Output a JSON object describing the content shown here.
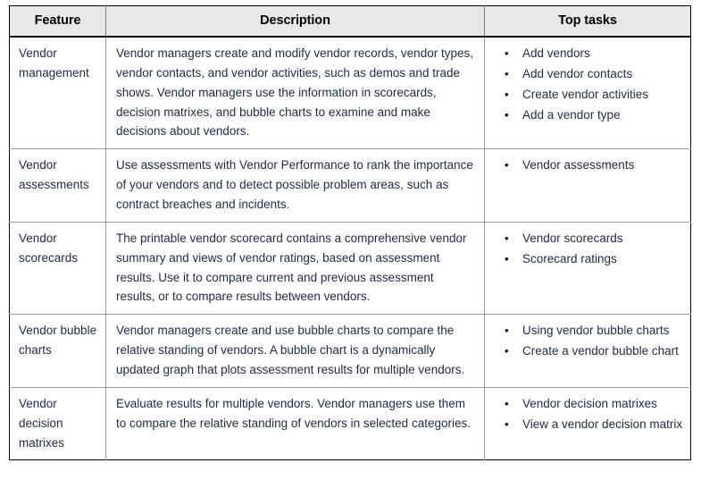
{
  "table": {
    "columns": [
      {
        "label": "Feature"
      },
      {
        "label": "Description"
      },
      {
        "label": "Top tasks"
      }
    ],
    "rows": [
      {
        "feature": "Vendor management",
        "description": "Vendor managers create and modify vendor records, vendor types, vendor contacts, and vendor activities, such as demos and trade shows. Vendor managers use the information in scorecards, decision matrixes, and bubble charts to examine and make decisions about vendors.",
        "tasks": [
          "Add vendors",
          "Add vendor contacts",
          "Create vendor activities",
          "Add a vendor type"
        ]
      },
      {
        "feature": "Vendor assessments",
        "description": "Use assessments with Vendor Performance to rank the importance of your vendors and to detect possible problem areas, such as contract breaches and incidents.",
        "tasks": [
          "Vendor assessments"
        ]
      },
      {
        "feature": "Vendor scorecards",
        "description": "The printable vendor scorecard contains a comprehensive vendor summary and views of vendor ratings, based on assessment results. Use it to compare current and previous assessment results, or to compare results between vendors.",
        "tasks": [
          "Vendor scorecards",
          "Scorecard ratings"
        ]
      },
      {
        "feature": "Vendor bubble charts",
        "description": "Vendor managers create and use bubble charts to compare the relative standing of vendors. A bubble chart is a dynamically updated graph that plots assessment results for multiple vendors.",
        "tasks": [
          "Using vendor bubble charts",
          "Create a vendor bubble chart"
        ]
      },
      {
        "feature": "Vendor decision matrixes",
        "description": "Evaluate results for multiple vendors. Vendor managers use them to compare the relative standing of vendors in selected categories.",
        "tasks": [
          "Vendor decision matrixes",
          "View a vendor decision matrix"
        ]
      }
    ],
    "bullet_glyph": "•"
  }
}
